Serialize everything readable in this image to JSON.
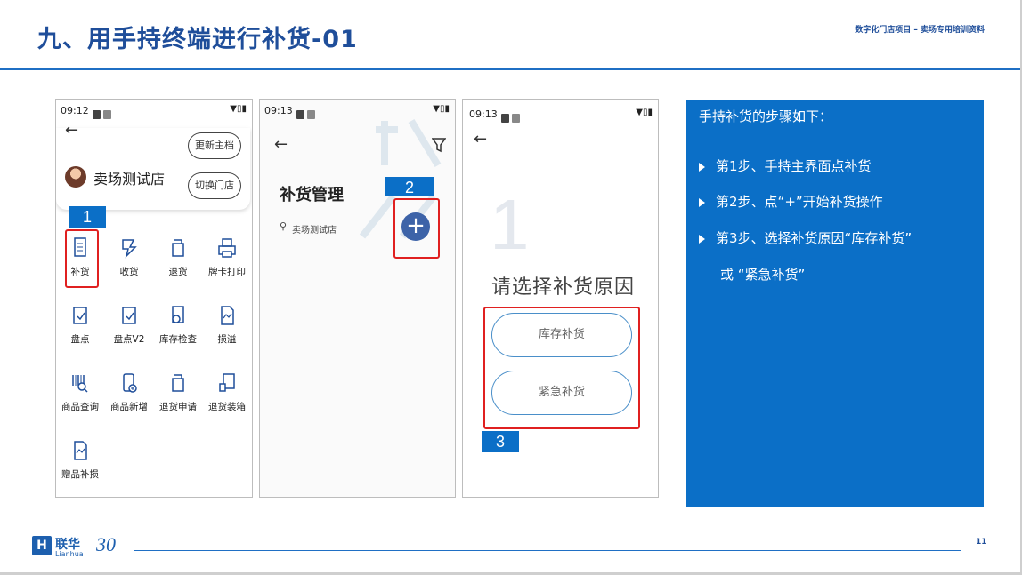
{
  "header": {
    "title": "九、用手持终端进行补货-01",
    "subtitle": "数字化门店项目 – 卖场专用培训资料"
  },
  "phone1": {
    "time": "09:12",
    "update_btn": "更新主档",
    "switch_btn": "切换门店",
    "store_name": "卖场测试店",
    "badge": "1",
    "grid": [
      {
        "label": "补货",
        "icon": "restock-icon"
      },
      {
        "label": "收货",
        "icon": "receive-icon"
      },
      {
        "label": "退货",
        "icon": "return-icon"
      },
      {
        "label": "牌卡打印",
        "icon": "printer-icon"
      },
      {
        "label": "盘点",
        "icon": "inventory-icon"
      },
      {
        "label": "盘点V2",
        "icon": "inventory-v2-icon"
      },
      {
        "label": "库存检查",
        "icon": "stock-check-icon"
      },
      {
        "label": "损溢",
        "icon": "loss-icon"
      },
      {
        "label": "商品查询",
        "icon": "barcode-search-icon"
      },
      {
        "label": "商品新增",
        "icon": "add-product-icon"
      },
      {
        "label": "退货申请",
        "icon": "return-request-icon"
      },
      {
        "label": "退货装箱",
        "icon": "return-packing-icon"
      },
      {
        "label": "赠品补损",
        "icon": "gift-loss-icon"
      }
    ]
  },
  "phone2": {
    "time": "09:13",
    "title": "补货管理",
    "location": "卖场测试店",
    "badge": "2",
    "fab": "+"
  },
  "phone3": {
    "time": "09:13",
    "prompt": "请选择补货原因",
    "btn_stock": "库存补货",
    "btn_urgent": "紧急补货",
    "badge": "3",
    "watermark": "1"
  },
  "panel": {
    "heading": "手持补货的步骤如下：",
    "steps": [
      "第1步、手持主界面点补货",
      "第2步、点“+”开始补货操作",
      "第3步、选择补货原因“库存补货”"
    ],
    "continuation": "或 “紧急补货”"
  },
  "footer": {
    "logo_cn": "联华",
    "logo_en": "Lianhua",
    "logo_mark": "H",
    "logo_30": "30",
    "page": "11"
  },
  "colors": {
    "brand_blue": "#0b6fc7",
    "title_blue": "#1f4e9a",
    "highlight_red": "#e02020"
  }
}
